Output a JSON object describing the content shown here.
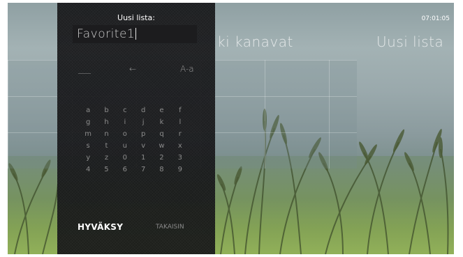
{
  "clock": "07:01:05",
  "background": {
    "left_heading": "ki kanavat",
    "right_heading": "Uusi lista"
  },
  "keyboard": {
    "title": "Uusi lista:",
    "input_value": "Favorite1",
    "space_key": "___",
    "backspace_key": "←",
    "case_key": "A-a",
    "keys": [
      "a",
      "b",
      "c",
      "d",
      "e",
      "f",
      "g",
      "h",
      "i",
      "j",
      "k",
      "l",
      "m",
      "n",
      "o",
      "p",
      "q",
      "r",
      "s",
      "t",
      "u",
      "v",
      "w",
      "x",
      "y",
      "z",
      "0",
      "1",
      "2",
      "3",
      "4",
      "5",
      "6",
      "7",
      "8",
      "9"
    ],
    "accept_label": "HYVÄKSY",
    "back_label": "TAKAISIN"
  }
}
